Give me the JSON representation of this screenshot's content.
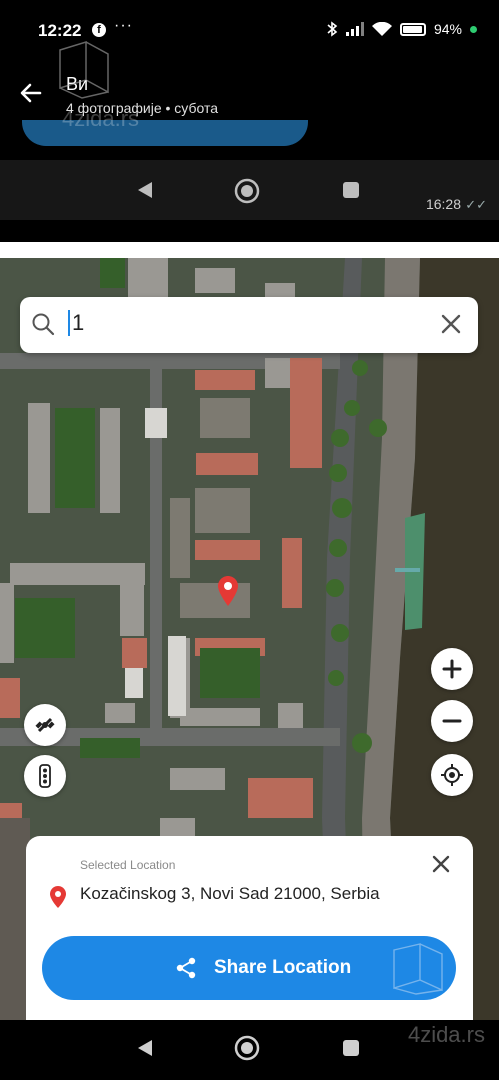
{
  "status_bar": {
    "time": "12:22",
    "app_icon": "facebook-icon",
    "more": "···",
    "battery": "94%"
  },
  "chat_header": {
    "title": "Ви",
    "subtitle": "4 фотографије  •  субота",
    "watermark": "4zida.rs"
  },
  "message": {
    "time": "16:28",
    "status_icon": "double-check-icon"
  },
  "map": {
    "search": {
      "value": "1",
      "placeholder": ""
    },
    "controls": {
      "zoom_in": "+",
      "zoom_out": "−"
    },
    "colors": {
      "pin": "#e53935",
      "accent": "#1e88e5",
      "river": "#3b3729"
    }
  },
  "selected_location": {
    "label": "Selected Location",
    "address": "Kozačinskog 3, Novi Sad 21000, Serbia",
    "share_label": "Share Location"
  },
  "bottom_nav": {
    "watermark": "4zida.rs"
  }
}
